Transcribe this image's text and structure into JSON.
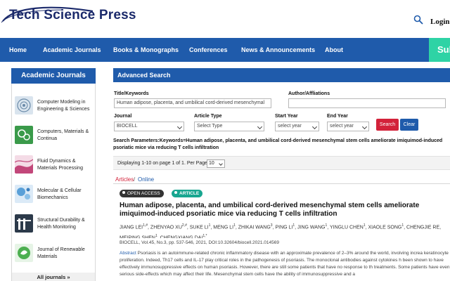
{
  "header": {
    "logo_text": "Tech Science Press",
    "login": "Login"
  },
  "nav": {
    "items": [
      "Home",
      "Academic Journals",
      "Books & Monographs",
      "Conferences",
      "News & Announcements",
      "About"
    ],
    "submit": "Sul"
  },
  "sidebar": {
    "title": "Academic Journals",
    "journals": [
      {
        "name": "Computer Modeling in Engineering & Sciences",
        "color": "#c9d6e3"
      },
      {
        "name": "Computers, Materials & Continua",
        "color": "#3a9a4a"
      },
      {
        "name": "Fluid Dynamics & Materials Processing",
        "color": "#c2477a"
      },
      {
        "name": "Molecular & Cellular Biomechanics",
        "color": "#5aa0d8"
      },
      {
        "name": "Structural Durability & Health Monitoring",
        "color": "#2c3a4a"
      },
      {
        "name": "Journal of Renewable Materials",
        "color": "#4caf50"
      }
    ],
    "all_journals": "All journals »"
  },
  "search": {
    "panel_title": "Advanced Search",
    "title_label": "Title/Keywords",
    "title_value": "Human adipose, placenta, and umbilical cord-derived mesenchymal",
    "author_label": "Author/Affliations",
    "author_value": "",
    "journal_label": "Journal",
    "journal_value": "BIOCELL",
    "type_label": "Article Type",
    "type_value": "Select Type",
    "start_label": "Start Year",
    "start_value": "select year",
    "end_label": "End Year",
    "end_value": "select year",
    "search_btn": "Search",
    "clear_btn": "Clear",
    "params": "Search Parameters:Keywords=Human adipose, placenta, and umbilical cord-derived mesenchymal stem cells ameliorate imiquimod-induced psoriatic mice via reducing T cells infiltration"
  },
  "results": {
    "displaying": "Displaying 1-10 on page 1 of 1. Per Page",
    "per_page": "10"
  },
  "tabs": {
    "articles": "Articles",
    "sep": "/",
    "online": "Online"
  },
  "article": {
    "badge_open": "OPEN ACCESS",
    "badge_type": "ARTICLE",
    "title": "Human adipose, placenta, and umbilical cord-derived mesenchymal stem cells ameliorate imiquimod-induced psoriatic mice via reducing T cells infiltration",
    "authors": [
      {
        "name": "JIANG LEI",
        "sup": "1,#"
      },
      {
        "name": "ZHENYAO XU",
        "sup": "2,#"
      },
      {
        "name": "SUKE LI",
        "sup": "1"
      },
      {
        "name": "MENG LI",
        "sup": "1"
      },
      {
        "name": "ZHIKAI WANG",
        "sup": "3"
      },
      {
        "name": "PING LI",
        "sup": "1"
      },
      {
        "name": "JING WANG",
        "sup": "1"
      },
      {
        "name": "YINGLU CHEN",
        "sup": "1"
      },
      {
        "name": "XIAOLE SONG",
        "sup": "1"
      },
      {
        "name": "CHENGJIE RE",
        "sup": ""
      },
      {
        "name": "MEIPING SHEN",
        "sup": "1"
      },
      {
        "name": "CHENGXIANG DAI",
        "sup": "1,*"
      }
    ],
    "meta": "BIOCELL, Vol.45, No.3, pp. 537-546, 2021, DOI:10.32604/biocell.2021.014569",
    "abstract_label": "Abstract",
    "abstract": "Psoriasis is an autoimmune-related chronic inflammatory disease with an approximate prevalence of 2–3% around the world, involving increa keratinocyte proliferation. Indeed, Th17 cells and IL-17 play critical roles in the pathogenesis of psoriasis. The monoclonal antibodies against cytokines h been shown to have effectively immunosuppressive effects on human psoriasis. However, there are still some patients that have no response to th treatments. Some patients have even serious side-effects which may affect their life. Mesenchymal stem cells have the ability of immunosuppressive and a"
  }
}
